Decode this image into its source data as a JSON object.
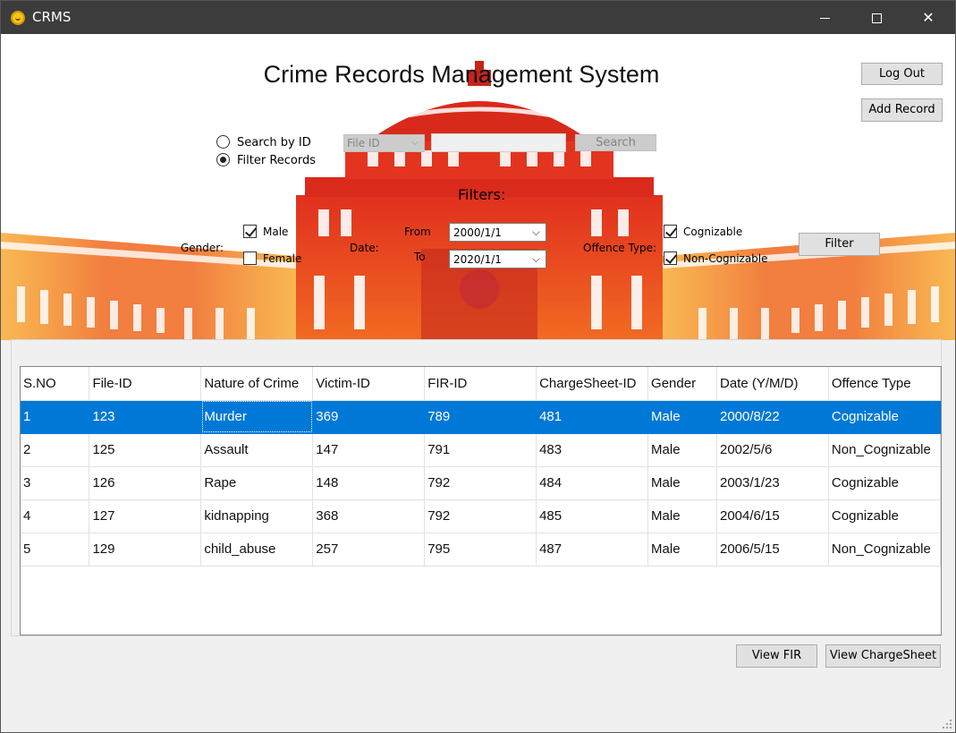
{
  "window": {
    "title": "CRMS"
  },
  "header": {
    "title": "Crime Records Management System"
  },
  "actions": {
    "logout_label": "Log Out",
    "add_record_label": "Add Record"
  },
  "search": {
    "radio_search_by_id": "Search by ID",
    "radio_filter_records": "Filter Records",
    "selected_mode": "Filter Records",
    "field_select": "File  ID",
    "text_value": "",
    "button_label": "Search"
  },
  "filters": {
    "heading": "Filters:",
    "gender_label": "Gender:",
    "male_label": "Male",
    "male_checked": true,
    "female_label": "Female",
    "female_checked": false,
    "date_label": "Date:",
    "from_label": "From",
    "from_value": "2000/1/1",
    "to_label": "To",
    "to_value": "2020/1/1",
    "offence_label": "Offence Type:",
    "cognizable_label": "Cognizable",
    "cognizable_checked": true,
    "noncognizable_label": "Non-Cognizable",
    "noncognizable_checked": true,
    "filter_button": "Filter"
  },
  "table": {
    "columns": [
      "S.NO",
      "File-ID",
      "Nature of Crime",
      "Victim-ID",
      "FIR-ID",
      "ChargeSheet-ID",
      "Gender",
      "Date (Y/M/D)",
      "Offence Type"
    ],
    "rows": [
      [
        "1",
        "123",
        "Murder",
        "369",
        "789",
        "481",
        "Male",
        "2000/8/22",
        "Cognizable"
      ],
      [
        "2",
        "125",
        "Assault",
        "147",
        "791",
        "483",
        "Male",
        "2002/5/6",
        "Non_Cognizable"
      ],
      [
        "3",
        "126",
        "Rape",
        "148",
        "792",
        "484",
        "Male",
        "2003/1/23",
        "Cognizable"
      ],
      [
        "4",
        "127",
        "kidnapping",
        "368",
        "792",
        "485",
        "Male",
        "2004/6/15",
        "Cognizable"
      ],
      [
        "5",
        "129",
        "child_abuse",
        "257",
        "795",
        "487",
        "Male",
        "2006/5/15",
        "Non_Cognizable"
      ]
    ],
    "selected_row": 0
  },
  "footer": {
    "view_fir_label": "View FIR",
    "view_chargesheet_label": "View ChargeSheet"
  },
  "colors": {
    "selection": "#0078d7",
    "titlebar": "#3c3c3c",
    "hero_red": "#e8321e",
    "hero_orange": "#f7931e"
  }
}
